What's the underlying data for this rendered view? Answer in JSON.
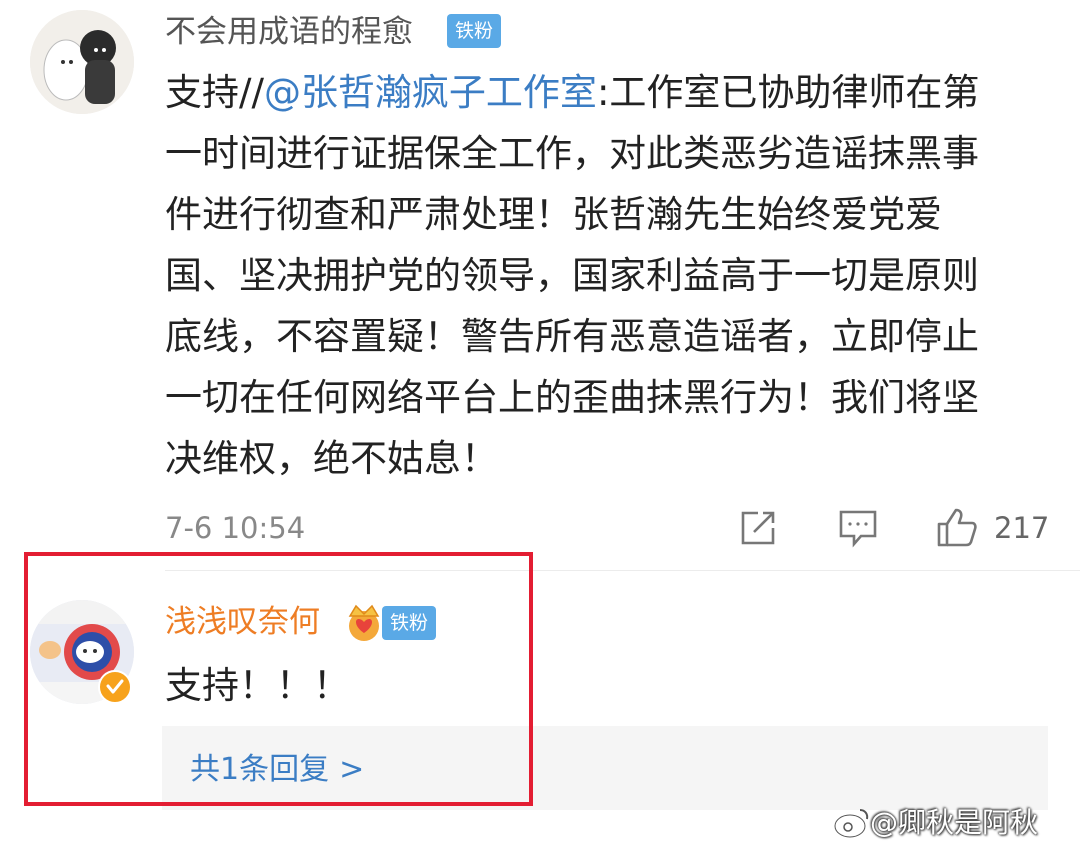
{
  "comment1": {
    "username": "不会用成语的程愈",
    "badge": "铁粉",
    "text_prefix": "支持//",
    "mention": "@张哲瀚疯子工作室",
    "lines": [
      ":工作室已协助律师在第",
      "一时间进行证据保全工作，对此类恶劣造谣抹黑事",
      "件进行彻查和严肃处理！张哲瀚先生始终爱党爱",
      "国、坚决拥护党的领导，国家利益高于一切是原则",
      "底线，不容置疑！警告所有恶意造谣者，立即停止",
      "一切在任何网络平台上的歪曲抹黑行为！我们将坚",
      "决维权，绝不姑息！"
    ],
    "time": "7-6 10:54",
    "likes": "217"
  },
  "comment2": {
    "username": "浅浅叹奈何",
    "badge": "铁粉",
    "text": "支持！！！",
    "replies_label": "共1条回复",
    "replies_chevron": ">"
  },
  "watermark": "@卿秋是阿秋",
  "icons": {
    "share": "share-icon",
    "comment": "comment-icon",
    "like": "thumbs-up-icon",
    "crown": "crown-badge-icon",
    "verified": "verified-icon"
  },
  "colors": {
    "mention": "#3b7dc4",
    "vip_name": "#ee7d24",
    "fan_badge": "#5aa9e6",
    "highlight": "#e31d32"
  }
}
